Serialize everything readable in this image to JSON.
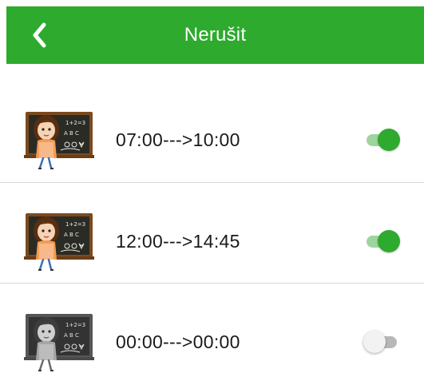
{
  "header": {
    "title": "Nerušit",
    "back_icon": "chevron-left-icon",
    "background_color": "#2eaa2e"
  },
  "schedules": [
    {
      "time_range": "07:00--->10:00",
      "enabled": true,
      "avatar": "teacher-colored"
    },
    {
      "time_range": "12:00--->14:45",
      "enabled": true,
      "avatar": "teacher-colored"
    },
    {
      "time_range": "00:00--->00:00",
      "enabled": false,
      "avatar": "teacher-grayscale"
    }
  ],
  "colors": {
    "accent": "#2eaa2e",
    "toggle_on_track": "#9ed49e",
    "toggle_off_track": "#b8b8b8",
    "divider": "#d9d9d9"
  }
}
